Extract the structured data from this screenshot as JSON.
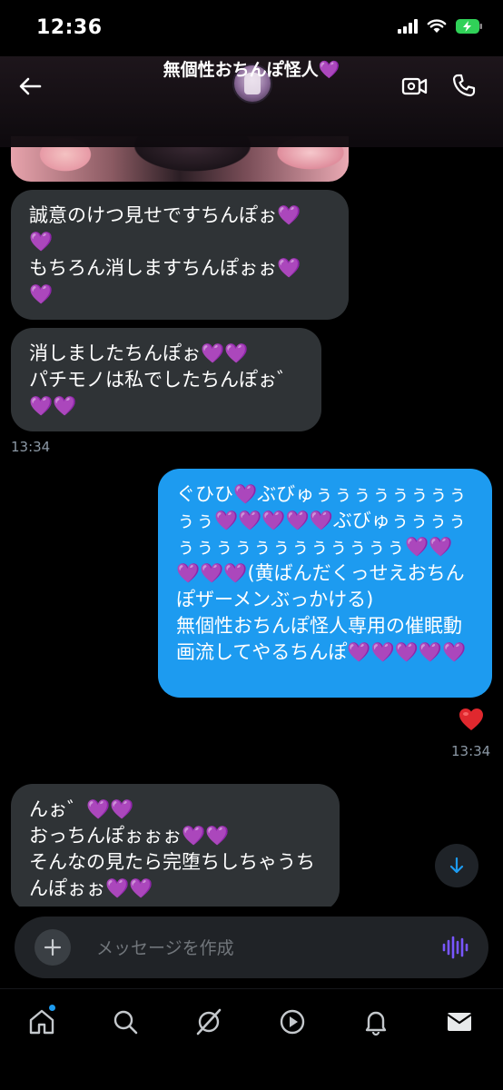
{
  "status_bar": {
    "time": "12:36"
  },
  "header": {
    "title": "無個性おちんぽ怪人💜"
  },
  "messages": [
    {
      "side": "received",
      "text": "誠意のけつ見せですちんぽぉ💜\n💜\nもちろん消しますちんぽぉぉ💜\n💜"
    },
    {
      "side": "received",
      "text": "消しましたちんぽぉ💜💜\nパチモノは私でしたちんぽぉ゛\n💜💜",
      "time": "13:34"
    },
    {
      "side": "sent",
      "text": "ぐひひ💜ぶびゅぅぅぅぅぅぅぅぅぅぅ💜💜💜💜💜ぶびゅぅぅぅぅぅぅぅぅぅぅぅぅぅぅぅぅ💜💜💜💜💜(黄ばんだくっせえおちんぽザーメンぶっかける)\n無個性おちんぽ怪人専用の催眠動画流してやるちんぽ💜💜💜💜💜",
      "reaction": "❤️",
      "time": "13:34"
    },
    {
      "side": "received",
      "text": "んぉ゛💜💜\nおっちんぽぉぉぉ💜💜\nそんなの見たら完堕ちしちゃうちんぽぉぉ💜💜"
    }
  ],
  "composer": {
    "placeholder": "メッセージを作成"
  },
  "nav": {
    "items": [
      "home-icon",
      "search-icon",
      "grok-icon",
      "video-icon",
      "notifications-icon",
      "messages-icon"
    ]
  },
  "colors": {
    "sent_bubble": "#1d9bf0",
    "received_bubble": "#2f3336",
    "accent": "#1d9bf0"
  }
}
